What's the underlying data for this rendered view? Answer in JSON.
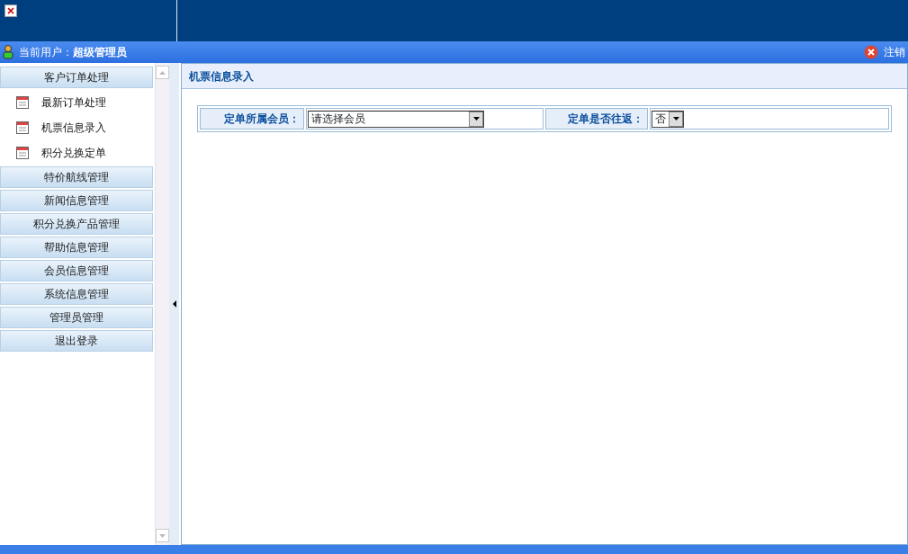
{
  "user_bar": {
    "label": "当前用户：",
    "user": "超级管理员",
    "logout": "注销"
  },
  "sidebar": {
    "groups": [
      {
        "label": "客户订单处理",
        "children": [
          "最新订单处理",
          "机票信息录入",
          "积分兑换定单"
        ]
      },
      {
        "label": "特价航线管理"
      },
      {
        "label": "新闻信息管理"
      },
      {
        "label": "积分兑换产品管理"
      },
      {
        "label": "帮助信息管理"
      },
      {
        "label": "会员信息管理"
      },
      {
        "label": "系统信息管理"
      },
      {
        "label": "管理员管理"
      },
      {
        "label": "退出登录"
      }
    ]
  },
  "main": {
    "title": "机票信息录入",
    "form": [
      {
        "label": "定单所属会员：",
        "value": "请选择会员",
        "kind": "wide"
      },
      {
        "label": "定单是否往返：",
        "value": "否",
        "kind": "narrow"
      }
    ]
  }
}
